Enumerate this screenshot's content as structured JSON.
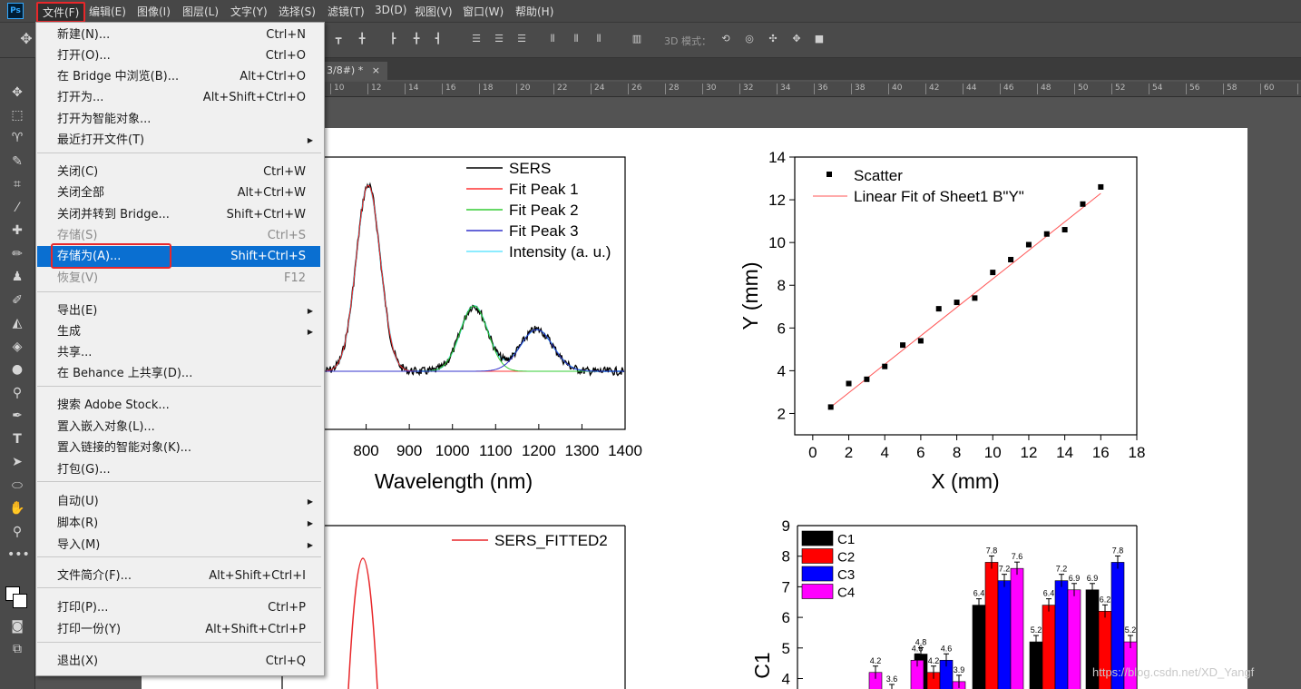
{
  "app": {
    "logo": "Ps"
  },
  "menubar": {
    "items": [
      "文件(F)",
      "编辑(E)",
      "图像(I)",
      "图层(L)",
      "文字(Y)",
      "选择(S)",
      "滤镜(T)",
      "3D(D)",
      "视图(V)",
      "窗口(W)",
      "帮助(H)"
    ]
  },
  "options_bar": {
    "mode_label": "3D 模式："
  },
  "document": {
    "tab_title": "3/8#) *",
    "close": "×"
  },
  "ruler": {
    "ticks": [
      "10",
      "12",
      "14",
      "16",
      "18",
      "20",
      "22",
      "24",
      "26",
      "28",
      "30",
      "32",
      "34",
      "36",
      "38",
      "40",
      "42",
      "44",
      "46",
      "48",
      "50",
      "52",
      "54",
      "56",
      "58",
      "60",
      "62"
    ]
  },
  "file_menu": {
    "items": [
      {
        "label": "新建(N)...",
        "shortcut": "Ctrl+N"
      },
      {
        "label": "打开(O)...",
        "shortcut": "Ctrl+O"
      },
      {
        "label": "在 Bridge 中浏览(B)...",
        "shortcut": "Alt+Ctrl+O"
      },
      {
        "label": "打开为...",
        "shortcut": "Alt+Shift+Ctrl+O"
      },
      {
        "label": "打开为智能对象...",
        "shortcut": ""
      },
      {
        "label": "最近打开文件(T)",
        "shortcut": "",
        "submenu": true
      },
      {
        "label": "关闭(C)",
        "shortcut": "Ctrl+W"
      },
      {
        "label": "关闭全部",
        "shortcut": "Alt+Ctrl+W"
      },
      {
        "label": "关闭并转到 Bridge...",
        "shortcut": "Shift+Ctrl+W"
      },
      {
        "label": "存储(S)",
        "shortcut": "Ctrl+S",
        "disabled": true
      },
      {
        "label": "存储为(A)...",
        "shortcut": "Shift+Ctrl+S",
        "highlighted": true
      },
      {
        "label": "恢复(V)",
        "shortcut": "F12",
        "disabled": true
      },
      {
        "label": "导出(E)",
        "shortcut": "",
        "submenu": true
      },
      {
        "label": "生成",
        "shortcut": "",
        "submenu": true
      },
      {
        "label": "共享...",
        "shortcut": ""
      },
      {
        "label": "在 Behance 上共享(D)...",
        "shortcut": ""
      },
      {
        "label": "搜索 Adobe Stock...",
        "shortcut": ""
      },
      {
        "label": "置入嵌入对象(L)...",
        "shortcut": ""
      },
      {
        "label": "置入链接的智能对象(K)...",
        "shortcut": ""
      },
      {
        "label": "打包(G)...",
        "shortcut": ""
      },
      {
        "label": "自动(U)",
        "shortcut": "",
        "submenu": true
      },
      {
        "label": "脚本(R)",
        "shortcut": "",
        "submenu": true
      },
      {
        "label": "导入(M)",
        "shortcut": "",
        "submenu": true
      },
      {
        "label": "文件简介(F)...",
        "shortcut": "Alt+Shift+Ctrl+I"
      },
      {
        "label": "打印(P)...",
        "shortcut": "Ctrl+P"
      },
      {
        "label": "打印一份(Y)",
        "shortcut": "Alt+Shift+Ctrl+P"
      },
      {
        "label": "退出(X)",
        "shortcut": "Ctrl+Q"
      }
    ],
    "arrow_glyph": "▶"
  },
  "chart_data": [
    {
      "type": "line",
      "legend": [
        "SERS",
        "Fit Peak 1",
        "Fit Peak 2",
        "Fit Peak 3",
        "Intensity (a. u.)"
      ],
      "xlabel": "Wavelength (nm)",
      "x_ticks": [
        "800",
        "900",
        "1000",
        "1100",
        "1200",
        "1300",
        "1400"
      ],
      "peaks_nm": [
        805,
        1050,
        1195
      ],
      "colors": {
        "SERS": "#000000",
        "Fit Peak 1": "#ff3333",
        "Fit Peak 2": "#33cc33",
        "Fit Peak 3": "#3333cc",
        "Intensity (a. u.)": "#66e6ff"
      }
    },
    {
      "type": "scatter",
      "legend": [
        "Scatter",
        "Linear Fit of Sheet1 B\"Y\""
      ],
      "xlabel": "X (mm)",
      "ylabel": "Y (mm)",
      "xlim": [
        -1,
        18
      ],
      "ylim": [
        1,
        14
      ],
      "x_ticks": [
        "0",
        "2",
        "4",
        "6",
        "8",
        "10",
        "12",
        "14",
        "16",
        "18"
      ],
      "y_ticks": [
        "2",
        "4",
        "6",
        "8",
        "10",
        "12",
        "14"
      ],
      "x": [
        1,
        2,
        3,
        4,
        5,
        6,
        7,
        8,
        9,
        10,
        11,
        12,
        13,
        14,
        15,
        16
      ],
      "y": [
        2.3,
        3.4,
        3.6,
        4.2,
        5.2,
        5.4,
        6.9,
        7.2,
        7.4,
        8.6,
        9.2,
        9.9,
        10.4,
        10.6,
        11.8,
        12.6
      ],
      "fit": {
        "x": [
          1,
          16
        ],
        "y": [
          2.3,
          12.3
        ]
      }
    },
    {
      "type": "line",
      "legend": [
        "SERS_FITTED2"
      ],
      "color": "#e8272a"
    },
    {
      "type": "bar",
      "ylabel": "C1",
      "ylim": [
        3.5,
        9
      ],
      "y_ticks": [
        "4",
        "5",
        "6",
        "7",
        "8",
        "9"
      ],
      "series": [
        {
          "name": "C1",
          "color": "#000000",
          "values": [
            null,
            null,
            4.8,
            6.4,
            5.2,
            6.9
          ]
        },
        {
          "name": "C2",
          "color": "#ff0000",
          "values": [
            null,
            3.6,
            4.2,
            7.8,
            6.4,
            6.2
          ]
        },
        {
          "name": "C3",
          "color": "#0000ff",
          "values": [
            null,
            null,
            4.6,
            7.2,
            7.2,
            7.8
          ]
        },
        {
          "name": "C4",
          "color": "#ff00ff",
          "values": [
            4.2,
            4.6,
            3.9,
            7.6,
            6.9,
            5.2
          ]
        }
      ],
      "data_labels": [
        {
          "group": 0,
          "series": 3,
          "text": "4.2"
        },
        {
          "group": 1,
          "series": 1,
          "text": "3.6"
        },
        {
          "group": 1,
          "series": 3,
          "text": "4.6"
        },
        {
          "group": 2,
          "series": 0,
          "text": "4.8"
        },
        {
          "group": 2,
          "series": 1,
          "text": "4.2"
        },
        {
          "group": 2,
          "series": 2,
          "text": "4.6"
        },
        {
          "group": 2,
          "series": 3,
          "text": "3.9"
        },
        {
          "group": 3,
          "series": 0,
          "text": "6.4"
        },
        {
          "group": 3,
          "series": 1,
          "text": "7.8"
        },
        {
          "group": 3,
          "series": 2,
          "text": "7.2"
        },
        {
          "group": 3,
          "series": 3,
          "text": "7.6"
        },
        {
          "group": 4,
          "series": 0,
          "text": "5.2"
        },
        {
          "group": 4,
          "series": 1,
          "text": "6.4"
        },
        {
          "group": 4,
          "series": 2,
          "text": "7.2"
        },
        {
          "group": 4,
          "series": 3,
          "text": "6.9"
        },
        {
          "group": 5,
          "series": 0,
          "text": "6.9"
        },
        {
          "group": 5,
          "series": 1,
          "text": "6.2"
        },
        {
          "group": 5,
          "series": 2,
          "text": "7.8"
        },
        {
          "group": 5,
          "series": 3,
          "text": "5.2"
        }
      ]
    }
  ],
  "watermark": "https://blog.csdn.net/XD_Yangf"
}
